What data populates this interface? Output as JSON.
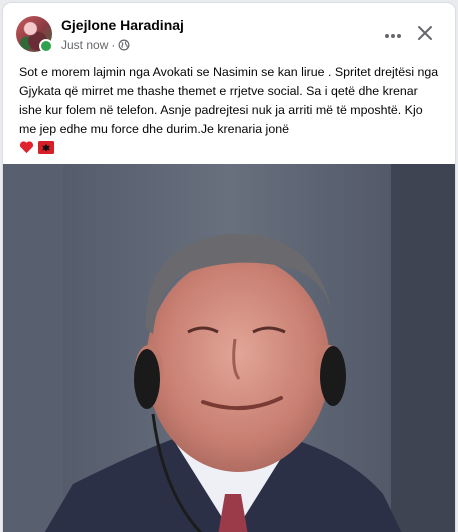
{
  "post": {
    "author": "Gjejlone Haradinaj",
    "timestamp": "Just now",
    "dot": "·",
    "privacy_icon": "globe-icon",
    "more_icon": "more-horizontal-icon",
    "close_icon": "close-icon",
    "text": "Sot e morem lajmin nga Avokati se Nasimin se kan lirue . Spritet drejtësi nga Gjykata që mirret me thashe themet e rrjetve social. Sa i qetë dhe krenar ishe kur folem në telefon. Asnje padrejtesi nuk ja arriti më të mposhtë. Kjo me jep edhe mu force dhe durim.Je krenaria jonë",
    "emojis": [
      "red-heart-emoji",
      "albania-flag-emoji"
    ]
  },
  "colors": {
    "author_text": "#050505",
    "meta_text": "#65676b",
    "online_status": "#31a24c",
    "card_bg": "#ffffff",
    "page_bg": "#e9ebee"
  }
}
